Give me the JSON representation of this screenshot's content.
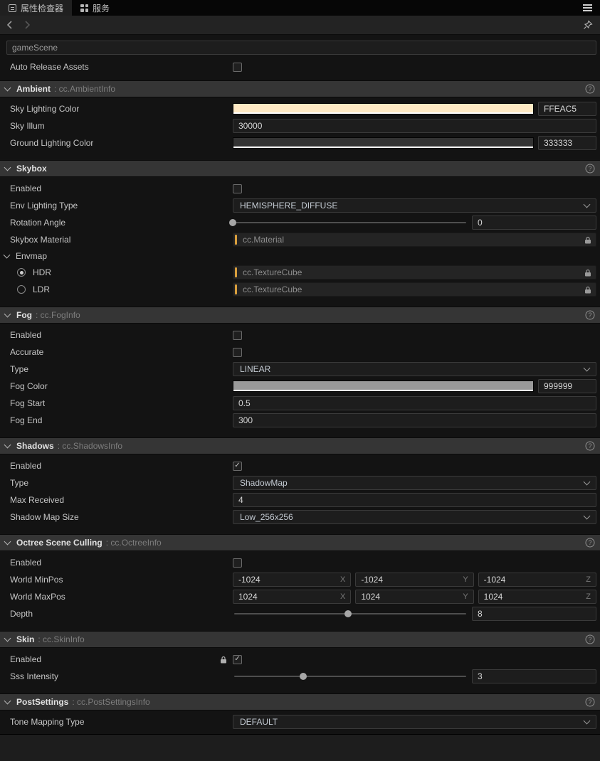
{
  "tabbar": {
    "tabs": [
      {
        "label": "属性检查器"
      },
      {
        "label": "服务"
      }
    ]
  },
  "scene": {
    "name": "gameScene",
    "auto_release": {
      "label": "Auto Release Assets",
      "checked": false
    }
  },
  "axis": {
    "x": "X",
    "y": "Y",
    "z": "Z"
  },
  "colors": {
    "asset_accent": "#D99F3C",
    "sky_lighting_swatch": "#FFEAC5",
    "ground_lighting_swatch": "#333333",
    "fog_swatch": "#999999"
  },
  "sections": {
    "ambient": {
      "title": "Ambient",
      "suffix": ": cc.AmbientInfo",
      "sky_lighting_color": {
        "label": "Sky Lighting Color",
        "hex": "FFEAC5",
        "swatch": "#FFEAC5"
      },
      "sky_illum": {
        "label": "Sky Illum",
        "value": "30000"
      },
      "ground_lighting_color": {
        "label": "Ground Lighting Color",
        "hex": "333333",
        "swatch": "#333333"
      }
    },
    "skybox": {
      "title": "Skybox",
      "suffix": "",
      "enabled": {
        "label": "Enabled",
        "checked": false
      },
      "env_lighting_type": {
        "label": "Env Lighting Type",
        "value": "HEMISPHERE_DIFFUSE"
      },
      "rotation_angle": {
        "label": "Rotation Angle",
        "value": "0",
        "handle": "0%"
      },
      "skybox_material": {
        "label": "Skybox Material",
        "placeholder": "cc.Material"
      },
      "envmap": {
        "label": "Envmap",
        "hdr": {
          "label": "HDR",
          "selected": true,
          "placeholder": "cc.TextureCube"
        },
        "ldr": {
          "label": "LDR",
          "selected": false,
          "placeholder": "cc.TextureCube"
        }
      }
    },
    "fog": {
      "title": "Fog",
      "suffix": ": cc.FogInfo",
      "enabled": {
        "label": "Enabled",
        "checked": false
      },
      "accurate": {
        "label": "Accurate",
        "checked": false
      },
      "type": {
        "label": "Type",
        "value": "LINEAR"
      },
      "fog_color": {
        "label": "Fog Color",
        "hex": "999999",
        "swatch": "#999999"
      },
      "fog_start": {
        "label": "Fog Start",
        "value": "0.5"
      },
      "fog_end": {
        "label": "Fog End",
        "value": "300"
      }
    },
    "shadows": {
      "title": "Shadows",
      "suffix": ": cc.ShadowsInfo",
      "enabled": {
        "label": "Enabled",
        "checked": true
      },
      "type": {
        "label": "Type",
        "value": "ShadowMap"
      },
      "max_received": {
        "label": "Max Received",
        "value": "4"
      },
      "shadow_map_size": {
        "label": "Shadow Map Size",
        "value": "Low_256x256"
      }
    },
    "octree": {
      "title": "Octree Scene Culling",
      "suffix": ": cc.OctreeInfo",
      "enabled": {
        "label": "Enabled",
        "checked": false
      },
      "world_min_pos": {
        "label": "World MinPos",
        "x": "-1024",
        "y": "-1024",
        "z": "-1024"
      },
      "world_max_pos": {
        "label": "World MaxPos",
        "x": "1024",
        "y": "1024",
        "z": "1024"
      },
      "depth": {
        "label": "Depth",
        "value": "8",
        "handle": "49%"
      }
    },
    "skin": {
      "title": "Skin",
      "suffix": ": cc.SkinInfo",
      "enabled": {
        "label": "Enabled",
        "checked": true,
        "locked": true
      },
      "sss_intensity": {
        "label": "Sss Intensity",
        "value": "3",
        "handle": "30%"
      }
    },
    "postsettings": {
      "title": "PostSettings",
      "suffix": ": cc.PostSettingsInfo",
      "tone_mapping_type": {
        "label": "Tone Mapping Type",
        "value": "DEFAULT"
      }
    }
  }
}
